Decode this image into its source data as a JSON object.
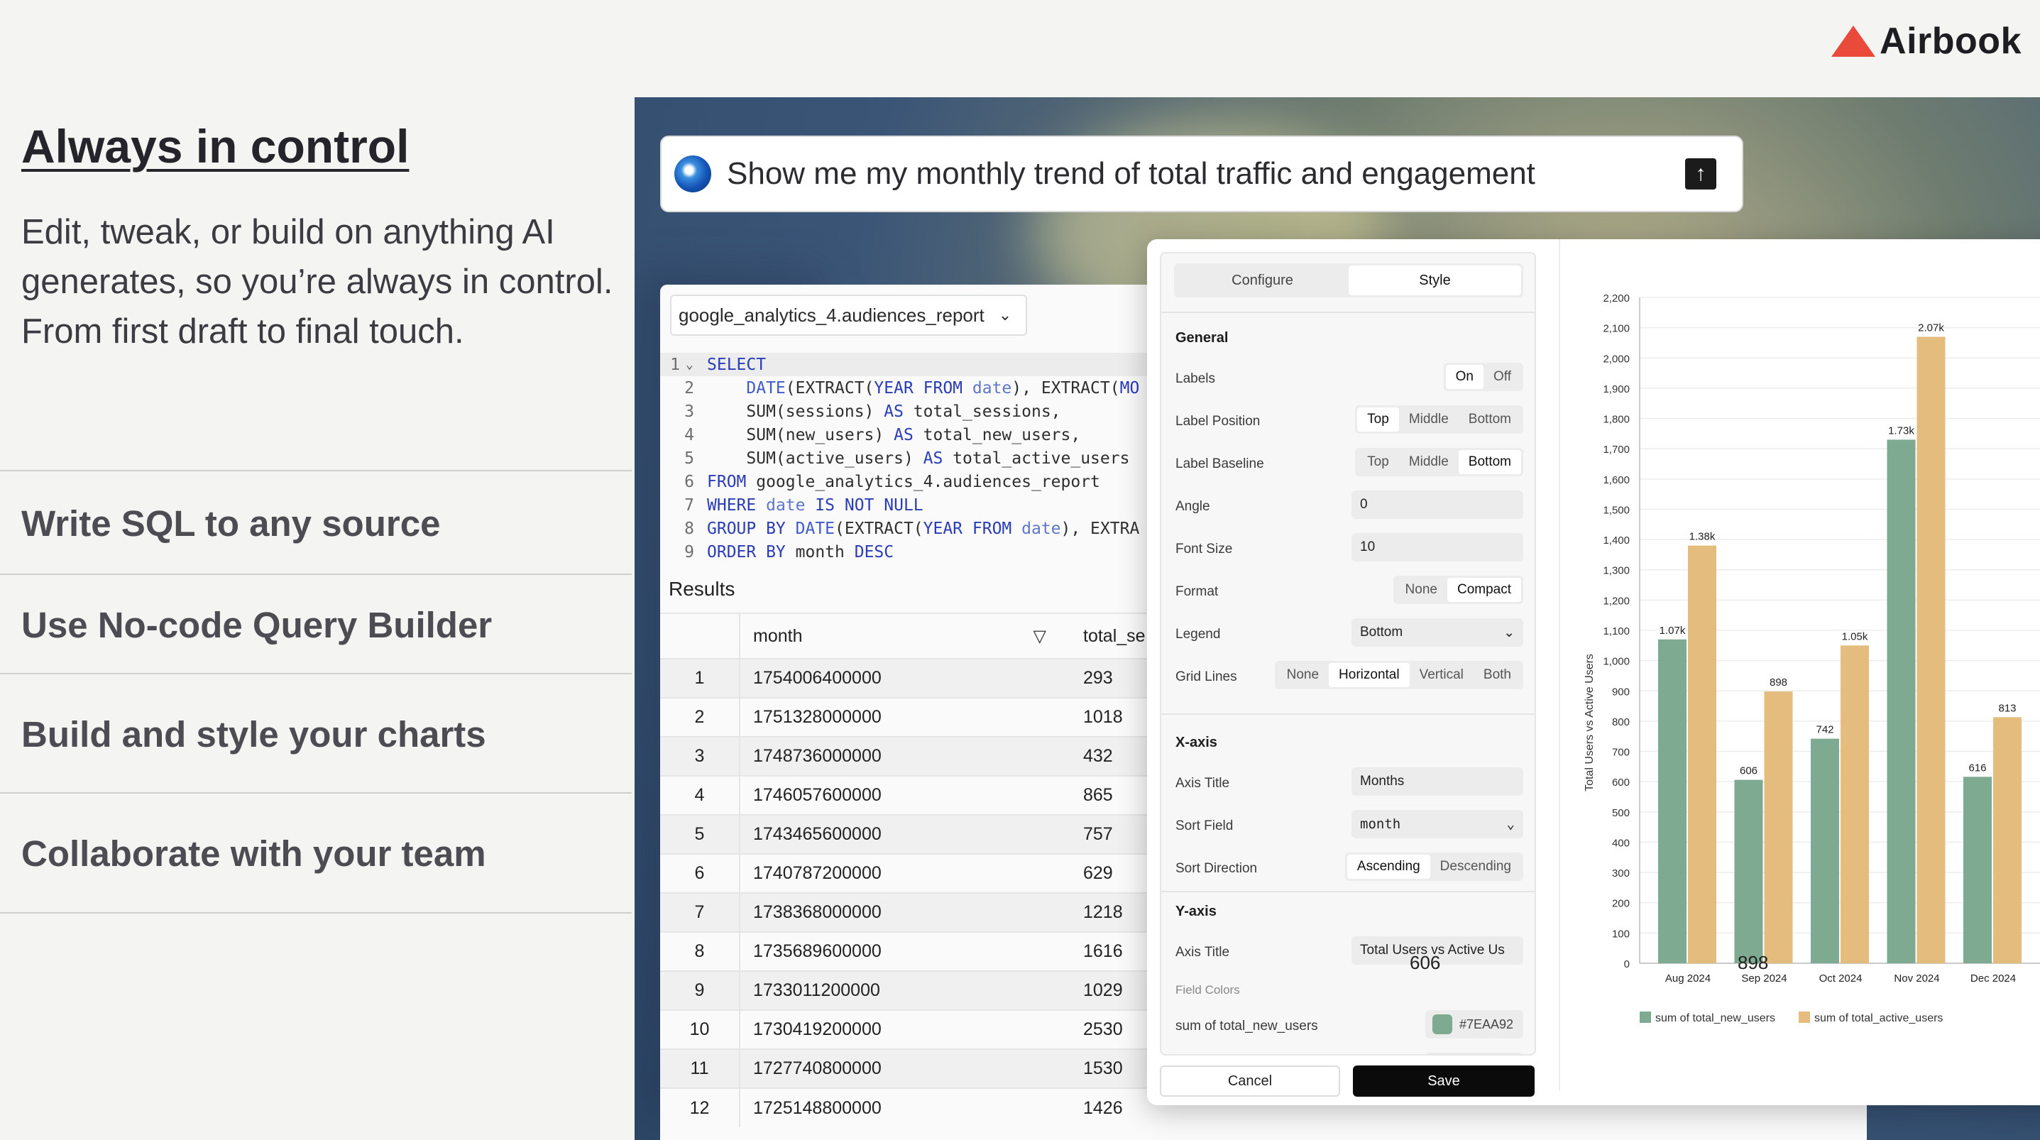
{
  "brand": {
    "name": "Airbook",
    "color": "#EA4A3A"
  },
  "hero": {
    "headline": "Always in control",
    "lead": "Edit, tweak, or build on anything AI generates, so you’re always in control. From first draft to final touch."
  },
  "features": [
    "Write SQL to any source",
    "Use No-code Query Builder",
    "Build and style your charts",
    "Collaborate with your team"
  ],
  "prompt": {
    "text": "Show me my monthly trend of total traffic and engagement",
    "send_icon": "arrow-up-icon"
  },
  "editor": {
    "dataset": "google_analytics_4.audiences_report",
    "lines": [
      {
        "n": "1",
        "parts": [
          [
            "kw",
            "SELECT"
          ]
        ]
      },
      {
        "n": "2",
        "parts": [
          [
            "t",
            "    "
          ],
          [
            "fn",
            "DATE"
          ],
          [
            "t",
            "(EXTRACT("
          ],
          [
            "kw",
            "YEAR FROM "
          ],
          [
            "id",
            "date"
          ],
          [
            "t",
            "), EXTRACT("
          ],
          [
            "kw",
            "MO"
          ]
        ]
      },
      {
        "n": "3",
        "parts": [
          [
            "t",
            "    SUM(sessions) "
          ],
          [
            "kw",
            "AS"
          ],
          [
            "t",
            " total_sessions,"
          ]
        ]
      },
      {
        "n": "4",
        "parts": [
          [
            "t",
            "    SUM(new_users) "
          ],
          [
            "kw",
            "AS"
          ],
          [
            "t",
            " total_new_users,"
          ]
        ]
      },
      {
        "n": "5",
        "parts": [
          [
            "t",
            "    SUM(active_users) "
          ],
          [
            "kw",
            "AS"
          ],
          [
            "t",
            " total_active_users"
          ]
        ]
      },
      {
        "n": "6",
        "parts": [
          [
            "kw",
            "FROM"
          ],
          [
            "t",
            " google_analytics_4.audiences_report"
          ]
        ]
      },
      {
        "n": "7",
        "parts": [
          [
            "kw",
            "WHERE "
          ],
          [
            "id",
            "date"
          ],
          [
            "kw",
            " IS NOT NULL"
          ]
        ]
      },
      {
        "n": "8",
        "parts": [
          [
            "kw",
            "GROUP BY "
          ],
          [
            "fn",
            "DATE"
          ],
          [
            "t",
            "(EXTRACT("
          ],
          [
            "kw",
            "YEAR FROM "
          ],
          [
            "id",
            "date"
          ],
          [
            "t",
            "), EXTRA"
          ]
        ]
      },
      {
        "n": "9",
        "parts": [
          [
            "kw",
            "ORDER BY"
          ],
          [
            "t",
            " month "
          ],
          [
            "kw",
            "DESC"
          ]
        ]
      }
    ]
  },
  "results": {
    "title": "Results",
    "columns": [
      "month",
      "total_se"
    ],
    "rows": [
      [
        "1",
        "1754006400000",
        "293"
      ],
      [
        "2",
        "1751328000000",
        "1018"
      ],
      [
        "3",
        "1748736000000",
        "432"
      ],
      [
        "4",
        "1746057600000",
        "865"
      ],
      [
        "5",
        "1743465600000",
        "757"
      ],
      [
        "6",
        "1740787200000",
        "629"
      ],
      [
        "7",
        "1738368000000",
        "1218"
      ],
      [
        "8",
        "1735689600000",
        "1616"
      ],
      [
        "9",
        "1733011200000",
        "1029"
      ],
      [
        "10",
        "1730419200000",
        "2530"
      ],
      [
        "11",
        "1727740800000",
        "1530"
      ],
      [
        "12",
        "1725148800000",
        "1426"
      ]
    ],
    "trailing": [
      "606",
      "898"
    ]
  },
  "config": {
    "tabs": [
      "Configure",
      "Style"
    ],
    "general": {
      "title": "General",
      "labels": {
        "label": "Labels",
        "options": [
          "On",
          "Off"
        ],
        "selected": "On"
      },
      "label_position": {
        "label": "Label Position",
        "options": [
          "Top",
          "Middle",
          "Bottom"
        ],
        "selected": "Top"
      },
      "label_baseline": {
        "label": "Label Baseline",
        "options": [
          "Top",
          "Middle",
          "Bottom"
        ],
        "selected": "Bottom"
      },
      "angle": {
        "label": "Angle",
        "value": "0"
      },
      "font_size": {
        "label": "Font Size",
        "value": "10"
      },
      "format": {
        "label": "Format",
        "options": [
          "None",
          "Compact"
        ],
        "selected": "Compact"
      },
      "legend": {
        "label": "Legend",
        "value": "Bottom"
      },
      "grid_lines": {
        "label": "Grid Lines",
        "options": [
          "None",
          "Horizontal",
          "Vertical",
          "Both"
        ],
        "selected": "Horizontal"
      }
    },
    "xaxis": {
      "title": "X-axis",
      "axis_title": {
        "label": "Axis Title",
        "value": "Months"
      },
      "sort_field": {
        "label": "Sort Field",
        "value": "month"
      },
      "sort_direction": {
        "label": "Sort Direction",
        "options": [
          "Ascending",
          "Descending"
        ],
        "selected": "Ascending"
      }
    },
    "yaxis": {
      "title": "Y-axis",
      "axis_title": {
        "label": "Axis Title",
        "value": "Total Users vs Active Us"
      },
      "field_colors_hint": "Field Colors",
      "colors": [
        {
          "label": "sum of total_new_users",
          "hex": "#7EAA92"
        },
        {
          "label": "",
          "hex": "#E4BD7E"
        }
      ]
    },
    "buttons": {
      "cancel": "Cancel",
      "save": "Save"
    }
  },
  "chart_data": {
    "type": "bar",
    "categories": [
      "Aug 2024",
      "Sep 2024",
      "Oct 2024",
      "Nov 2024",
      "Dec 2024"
    ],
    "series": [
      {
        "name": "sum of total_new_users",
        "color": "#7EAA92",
        "values": [
          1070,
          606,
          742,
          1730,
          616
        ]
      },
      {
        "name": "sum of total_active_users",
        "color": "#E4BD7E",
        "values": [
          1380,
          898,
          1050,
          2070,
          813
        ]
      }
    ],
    "data_labels": [
      [
        "1.07k",
        "606",
        "742",
        "1.73k",
        "616"
      ],
      [
        "1.38k",
        "898",
        "1.05k",
        "2.07k",
        "813"
      ]
    ],
    "ylabel": "Total Users vs Active Users",
    "ylim": [
      0,
      2200
    ],
    "yticks": [
      "0",
      "100",
      "200",
      "300",
      "400",
      "500",
      "600",
      "700",
      "800",
      "900",
      "1,000",
      "1,100",
      "1,200",
      "1,300",
      "1,400",
      "1,500",
      "1,600",
      "1,700",
      "1,800",
      "1,900",
      "2,000",
      "2,100",
      "2,200"
    ],
    "legend": "bottom",
    "grid": "horizontal"
  }
}
